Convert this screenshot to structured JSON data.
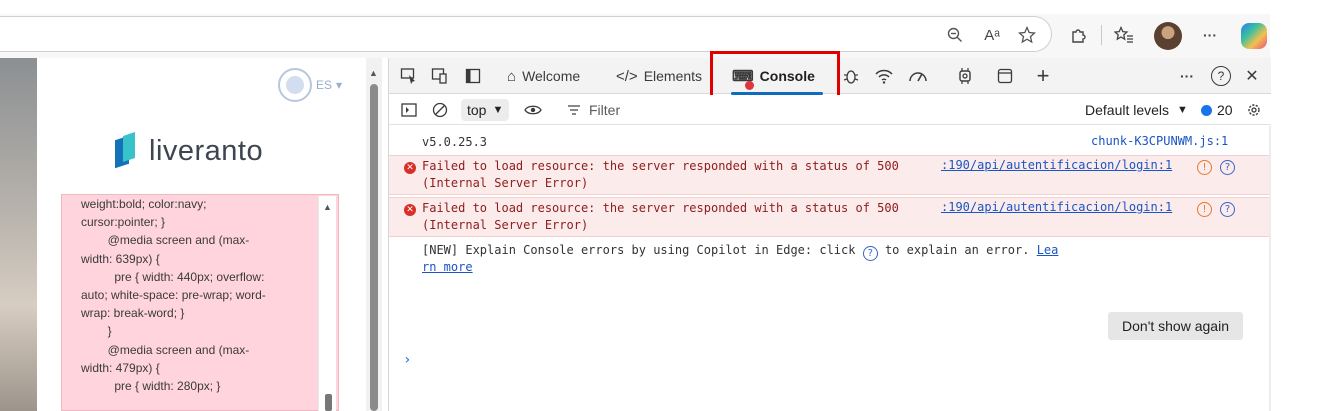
{
  "browser": {
    "toolbar_icons": [
      "zoom-out-icon",
      "read-aloud-icon",
      "favorite-star-icon",
      "extensions-icon",
      "favorites-icon",
      "profile-avatar",
      "more-icon",
      "copilot-icon"
    ],
    "read_aloud_glyph": "Aᵃ",
    "more_glyph": "···"
  },
  "website": {
    "language": "ES",
    "language_caret": "▾",
    "logo_text": "liveranto",
    "code_lines": [
      "weight:bold; color:navy;",
      "cursor:pointer; }",
      "        @media screen and (max-",
      "width: 639px) {",
      "          pre { width: 440px; overflow:",
      "auto; white-space: pre-wrap; word-",
      "wrap: break-word; }",
      "        }",
      "        @media screen and (max-",
      "width: 479px) {",
      "          pre { width: 280px; }"
    ]
  },
  "devtools": {
    "tabs": [
      {
        "label": "Welcome",
        "icon": "home-icon",
        "glyph": "⌂"
      },
      {
        "label": "Elements",
        "icon": "code-icon",
        "glyph": "</>"
      },
      {
        "label": "Console",
        "icon": "console-icon",
        "glyph": "⌨"
      }
    ],
    "right_glyphs": {
      "more": "···",
      "help": "?",
      "close": "✕",
      "add": "+"
    },
    "toolbar": {
      "context": "top",
      "context_caret": "▼",
      "filter_label": "Filter",
      "levels": "Default levels",
      "levels_caret": "▼",
      "message_count": "20"
    },
    "console": {
      "version_line": "v5.0.25.3",
      "version_source": "chunk-K3CPUNWM.js:1",
      "errors": [
        {
          "line1": "Failed to load resource: the server responded with a status of 500",
          "line2": "(Internal Server Error)",
          "source": ":190/api/autentificacion/login:1"
        },
        {
          "line1": "Failed to load resource: the server responded with a status of 500",
          "line2": "(Internal Server Error)",
          "source": ":190/api/autentificacion/login:1"
        }
      ],
      "copilot_prefix": "[NEW] Explain Console errors by using Copilot in Edge: click",
      "copilot_suffix": "to explain an error.",
      "learn_more_1": "Lea",
      "learn_more_2": "rn more",
      "dont_show_again": "Don't show again",
      "prompt": "›"
    }
  },
  "colors": {
    "highlight": "#e00000",
    "error_bg": "#fcebeb",
    "link": "#1a55c4",
    "tab_underline": "#0f6cbd",
    "code_box_bg": "#ffd4dd"
  }
}
